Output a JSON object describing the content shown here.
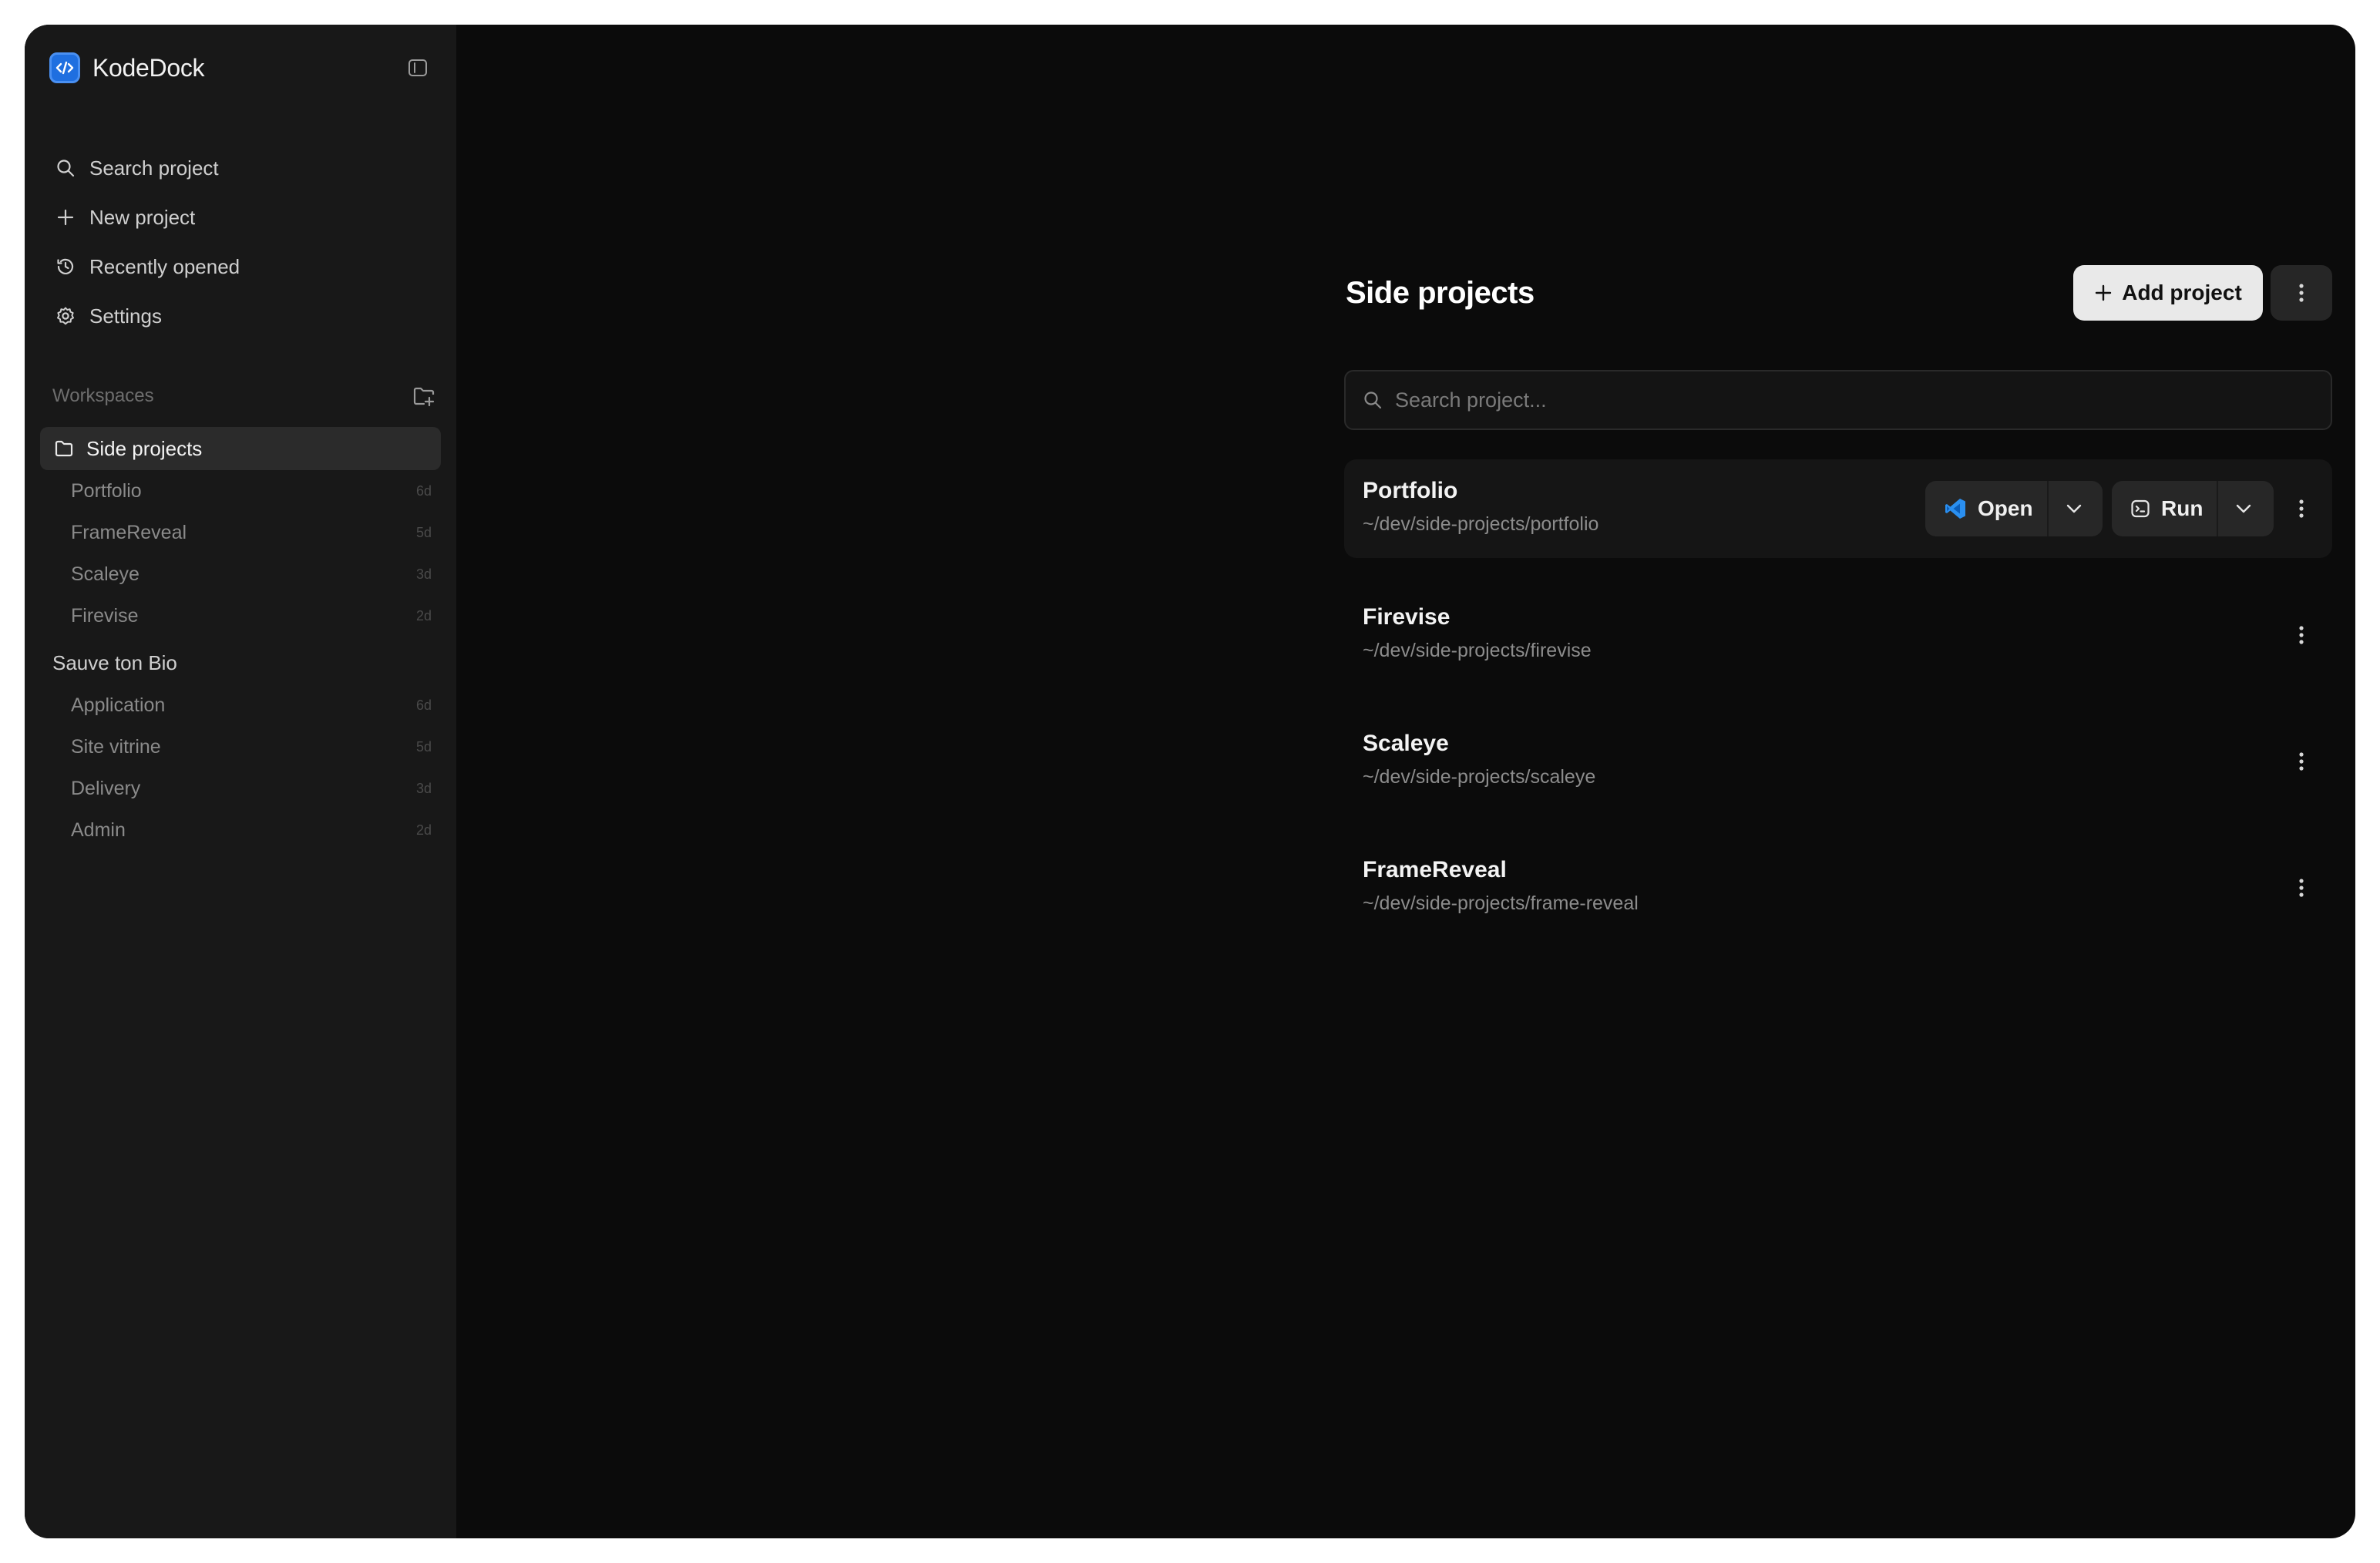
{
  "app": {
    "name": "KodeDock"
  },
  "nav": [
    {
      "id": "search",
      "label": "Search project",
      "icon": "search-icon"
    },
    {
      "id": "new",
      "label": "New project",
      "icon": "plus-icon"
    },
    {
      "id": "recent",
      "label": "Recently opened",
      "icon": "history-icon"
    },
    {
      "id": "settings",
      "label": "Settings",
      "icon": "gear-icon"
    }
  ],
  "workspaces": {
    "title": "Workspaces",
    "groups": [
      {
        "label": "Side projects",
        "active": true,
        "items": [
          {
            "label": "Portfolio",
            "age": "6d"
          },
          {
            "label": "FrameReveal",
            "age": "5d"
          },
          {
            "label": "Scaleye",
            "age": "3d"
          },
          {
            "label": "Firevise",
            "age": "2d"
          }
        ]
      },
      {
        "label": "Sauve ton Bio",
        "active": false,
        "items": [
          {
            "label": "Application",
            "age": "6d"
          },
          {
            "label": "Site vitrine",
            "age": "5d"
          },
          {
            "label": "Delivery",
            "age": "3d"
          },
          {
            "label": "Admin",
            "age": "2d"
          }
        ]
      }
    ]
  },
  "main": {
    "title": "Side projects",
    "add_label": "Add project",
    "search_placeholder": "Search project...",
    "open_label": "Open",
    "run_label": "Run",
    "projects": [
      {
        "name": "Portfolio",
        "path": "~/dev/side-projects/portfolio"
      },
      {
        "name": "Firevise",
        "path": "~/dev/side-projects/firevise"
      },
      {
        "name": "Scaleye",
        "path": "~/dev/side-projects/scaleye"
      },
      {
        "name": "FrameReveal",
        "path": "~/dev/side-projects/frame-reveal"
      }
    ]
  },
  "colors": {
    "accent": "#1f6fe0",
    "vscode": "#2a8ff0"
  }
}
